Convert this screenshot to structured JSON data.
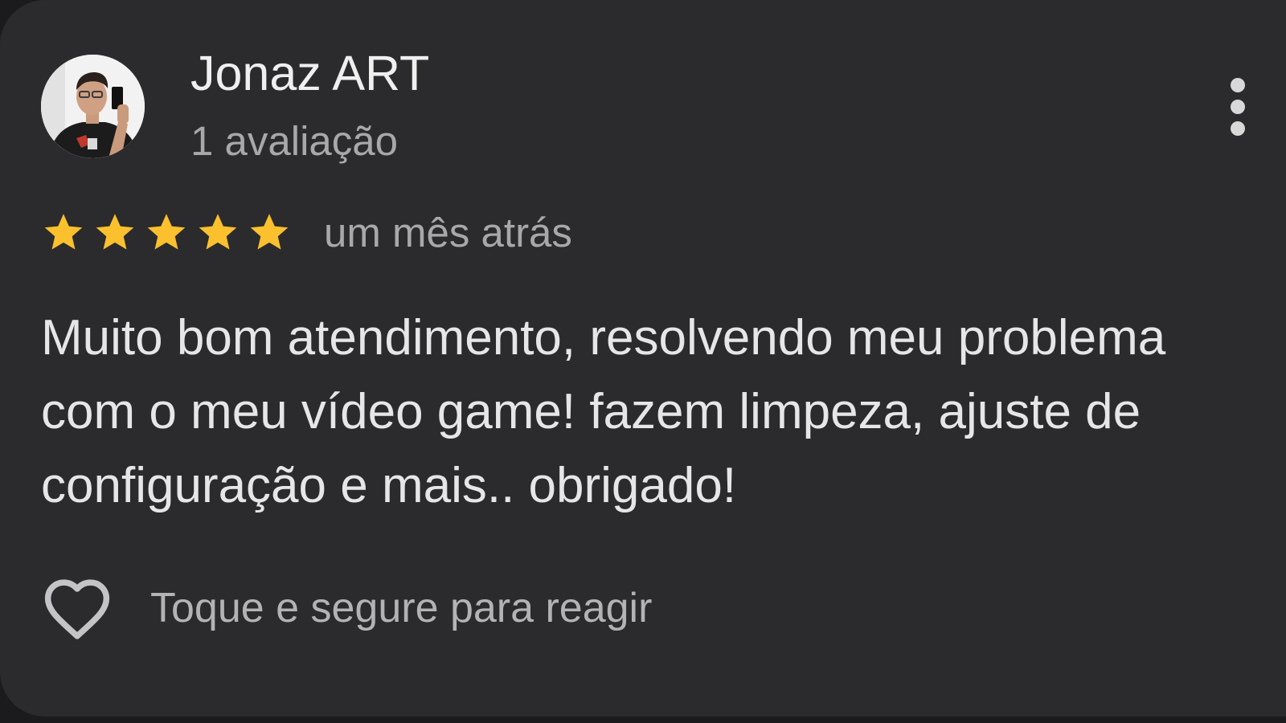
{
  "review": {
    "author": {
      "name": "Jonaz ART",
      "review_count": "1 avaliação",
      "avatar_icon": "user-photo-avatar"
    },
    "menu_icon": "more-vert-icon",
    "rating": {
      "stars": 5,
      "max": 5,
      "star_color": "#FBC02D"
    },
    "date": "um mês atrás",
    "text": "Muito bom atendimento, resolvendo meu problema com o meu vídeo game! fazem limpeza, ajuste de configuração e mais.. obrigado!",
    "reaction": {
      "icon": "heart-outline-icon",
      "label": "Toque e segure para reagir"
    }
  },
  "colors": {
    "card_background": "#2b2b2d",
    "primary_text": "#ececec",
    "secondary_text": "#a8a8aa",
    "star": "#FBC02D"
  }
}
